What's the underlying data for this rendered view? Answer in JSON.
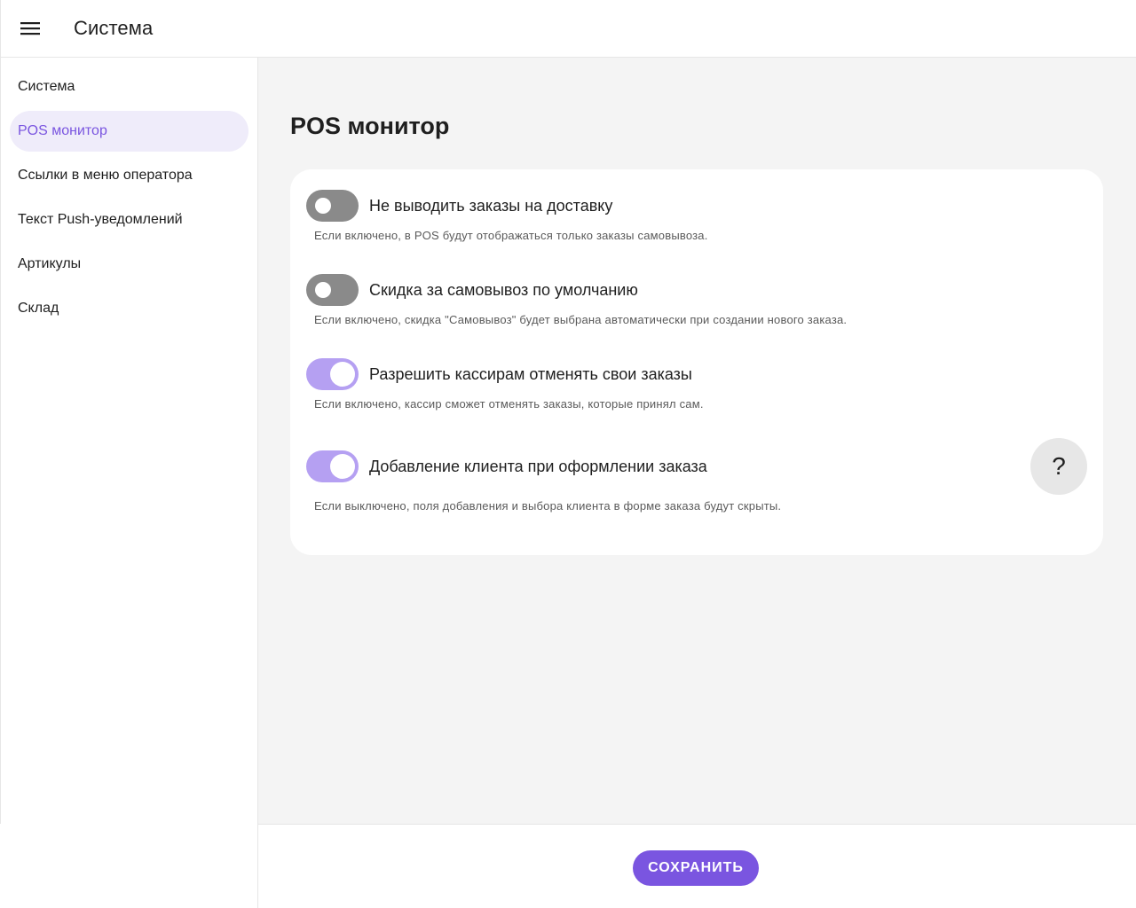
{
  "header": {
    "title": "Система",
    "menu_icon": "hamburger-menu-icon"
  },
  "sidebar": {
    "items": [
      {
        "label": "Система",
        "active": false
      },
      {
        "label": "POS монитор",
        "active": true
      },
      {
        "label": "Ссылки в меню оператора",
        "active": false
      },
      {
        "label": "Текст Push-уведомлений",
        "active": false
      },
      {
        "label": "Артикулы",
        "active": false
      },
      {
        "label": "Склад",
        "active": false
      }
    ]
  },
  "main": {
    "title": "POS монитор",
    "settings": [
      {
        "label": "Не выводить заказы на доставку",
        "description": "Если включено, в POS будут отображаться только заказы самовывоза.",
        "enabled": false
      },
      {
        "label": "Скидка за самовывоз по умолчанию",
        "description": "Если включено, скидка \"Самовывоз\" будет выбрана автоматически при создании нового заказа.",
        "enabled": false
      },
      {
        "label": "Разрешить кассирам отменять свои заказы",
        "description": "Если включено, кассир сможет отменять заказы, которые принял сам.",
        "enabled": true
      },
      {
        "label": "Добавление клиента при оформлении заказа",
        "description": "Если выключено, поля добавления и выбора клиента в форме заказа будут скрыты.",
        "enabled": true
      }
    ],
    "help_label": "?"
  },
  "footer": {
    "save_label": "СОХРАНИТЬ"
  },
  "colors": {
    "accent": "#7a55e0",
    "toggle_on": "#b5a0f2",
    "toggle_off": "#8a8a8a",
    "active_nav_bg": "#efecfa"
  }
}
